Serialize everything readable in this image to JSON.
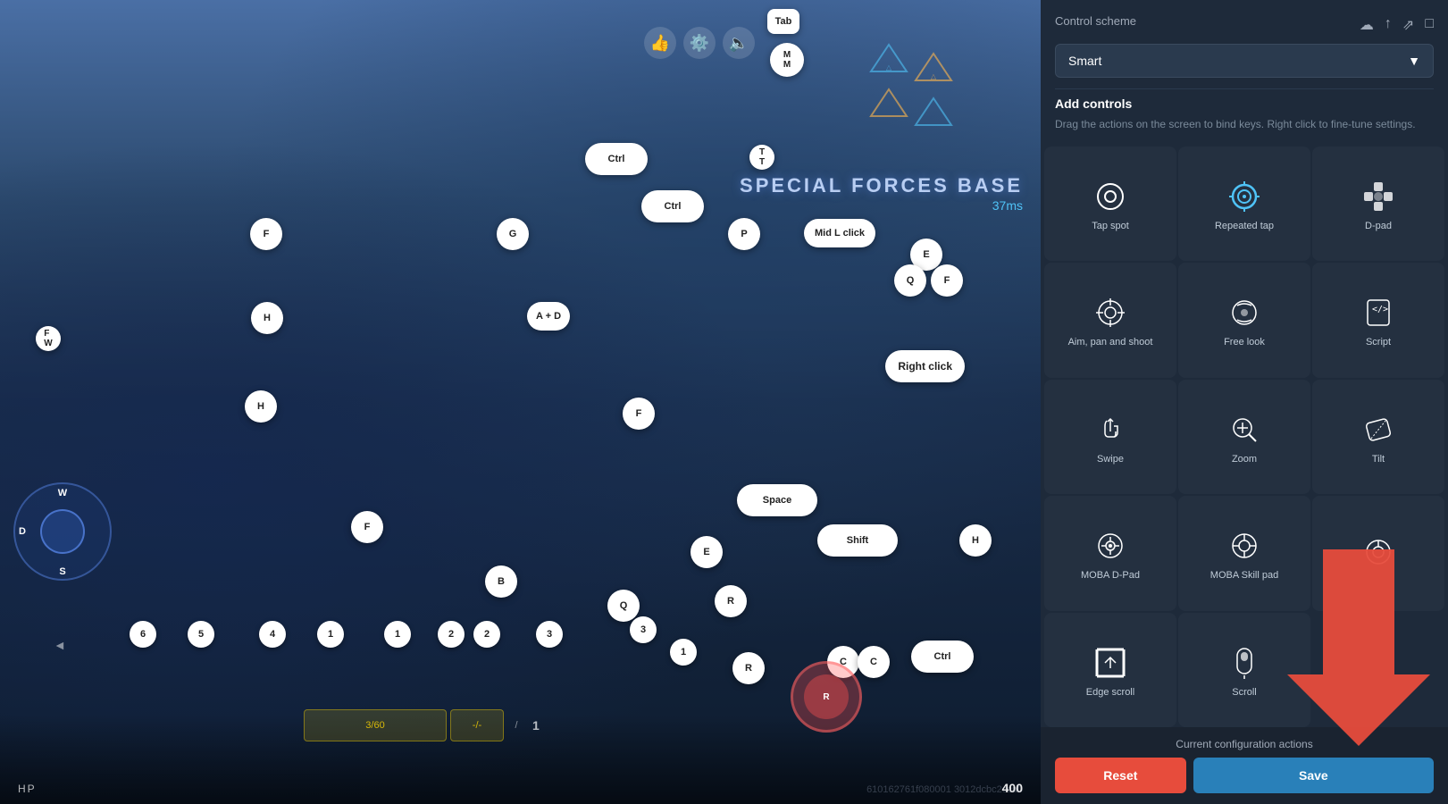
{
  "panel": {
    "title": "Control scheme",
    "scheme": "Smart",
    "add_controls_title": "Add controls",
    "add_controls_desc": "Drag the actions on the screen to bind keys. Right click to fine-tune settings.",
    "footer": {
      "config_label": "Current configuration actions",
      "reset_label": "Reset",
      "save_label": "Save"
    },
    "controls": [
      {
        "id": "tap-spot",
        "label": "Tap spot",
        "icon": "circle"
      },
      {
        "id": "repeated-tap",
        "label": "Repeated tap",
        "icon": "repeated"
      },
      {
        "id": "d-pad",
        "label": "D-pad",
        "icon": "dpad"
      },
      {
        "id": "aim-pan-shoot",
        "label": "Aim, pan and shoot",
        "icon": "aim"
      },
      {
        "id": "free-look",
        "label": "Free look",
        "icon": "freelook"
      },
      {
        "id": "script",
        "label": "Script",
        "icon": "script"
      },
      {
        "id": "swipe",
        "label": "Swipe",
        "icon": "swipe"
      },
      {
        "id": "zoom",
        "label": "Zoom",
        "icon": "zoom"
      },
      {
        "id": "tilt",
        "label": "Tilt",
        "icon": "tilt"
      },
      {
        "id": "moba-d-pad",
        "label": "MOBA D-Pad",
        "icon": "mobadpad"
      },
      {
        "id": "moba-skill-pad",
        "label": "MOBA Skill pad",
        "icon": "mobaskill"
      },
      {
        "id": "unknown",
        "label": "",
        "icon": "aim2"
      },
      {
        "id": "edge-scroll",
        "label": "Edge scroll",
        "icon": "edgescroll"
      },
      {
        "id": "scroll",
        "label": "Scroll",
        "icon": "scroll"
      },
      {
        "id": "empty",
        "label": "",
        "icon": ""
      }
    ]
  },
  "game": {
    "scene_name": "SPECIAL FORCES BASE",
    "ms_text": "37ms",
    "hp_label": "HP",
    "ammo": "400",
    "game_id": "610162761f080001\n3012dcbc2cca0",
    "keys": {
      "tab": "Tab",
      "mm": "M\nM",
      "ctrl1": "Ctrl",
      "ctrl2": "Ctrl",
      "ctrl3": "Ctrl",
      "t": "T\nT",
      "f1": "F",
      "f2": "F",
      "f3": "F",
      "f4": "F",
      "g": "G",
      "p": "P",
      "h1": "H",
      "h2": "H",
      "h3": "H",
      "e": "E",
      "q1": "Q",
      "q2": "Q",
      "b": "B",
      "r1": "R",
      "r2": "R",
      "s": "S",
      "d": "D",
      "space": "Space",
      "shift": "Shift",
      "c1": "C",
      "c2": "C",
      "mid_click": "Mid L click",
      "right_click": "Right click",
      "a_d": "A + D",
      "n1": "1",
      "n2": "2",
      "n3": "3",
      "n1b": "1",
      "n2b": "2",
      "n3b": "3",
      "n4": "4",
      "n5": "5",
      "n6": "6",
      "n1c": "1"
    }
  }
}
